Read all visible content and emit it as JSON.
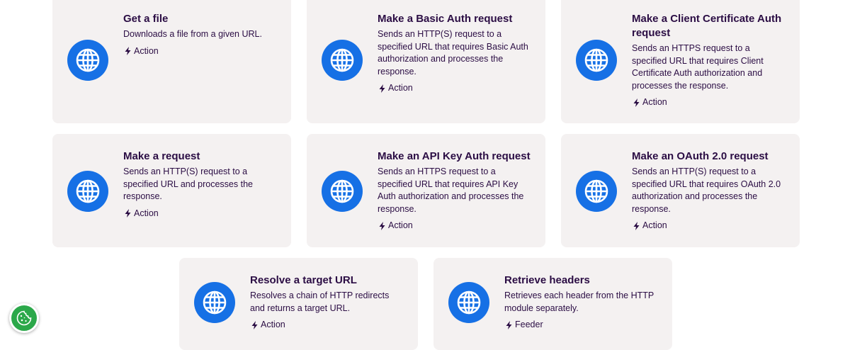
{
  "cards": [
    {
      "title": "Get a file",
      "description": "Downloads a file from a given URL.",
      "type": "Action"
    },
    {
      "title": "Make a Basic Auth request",
      "description": "Sends an HTTP(S) request to a specified URL that requires Basic Auth authorization and processes the response.",
      "type": "Action"
    },
    {
      "title": "Make a Client Certificate Auth request",
      "description": "Sends an HTTPS request to a specified URL that requires Client Certificate Auth authorization and processes the response.",
      "type": "Action"
    },
    {
      "title": "Make a request",
      "description": "Sends an HTTP(S) request to a specified URL and processes the response.",
      "type": "Action"
    },
    {
      "title": "Make an API Key Auth request",
      "description": "Sends an HTTPS request to a specified URL that requires API Key Auth authorization and processes the response.",
      "type": "Action"
    },
    {
      "title": "Make an OAuth 2.0 request",
      "description": "Sends an HTTP(S) request to a specified URL that requires OAuth 2.0 authorization and processes the response.",
      "type": "Action"
    },
    {
      "title": "Resolve a target URL",
      "description": "Resolves a chain of HTTP redirects and returns a target URL.",
      "type": "Action"
    },
    {
      "title": "Retrieve headers",
      "description": "Retrieves each header from the HTTP module separately.",
      "type": "Feeder"
    }
  ],
  "icons": {
    "card_icon": "globe-icon",
    "badge_icon": "lightning-bolt-icon",
    "cookie_icon": "cookie-icon"
  },
  "colors": {
    "card_background": "#f4f1f1",
    "icon_background": "#1670e5",
    "text": "#2b0d44",
    "cookie_button": "#2ba84a"
  }
}
